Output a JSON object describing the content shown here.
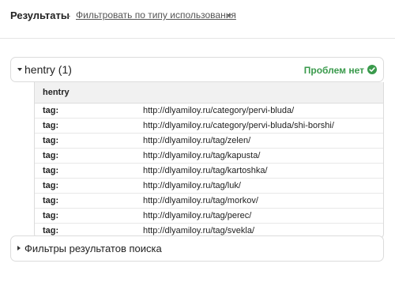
{
  "header": {
    "title": "Результаты",
    "separator": "-",
    "filter_link": "Фильтровать по типу использования"
  },
  "hentry_panel": {
    "title": "hentry (1)",
    "status": "Проблем нет",
    "status_icon": "check-circle-icon",
    "status_color": "#3a9a4c"
  },
  "table": {
    "header": "hentry",
    "rows": [
      {
        "key": "tag:",
        "value": "http://dlyamiloy.ru/category/pervi-bluda/"
      },
      {
        "key": "tag:",
        "value": "http://dlyamiloy.ru/category/pervi-bluda/shi-borshi/"
      },
      {
        "key": "tag:",
        "value": "http://dlyamiloy.ru/tag/zelen/"
      },
      {
        "key": "tag:",
        "value": "http://dlyamiloy.ru/tag/kapusta/"
      },
      {
        "key": "tag:",
        "value": "http://dlyamiloy.ru/tag/kartoshka/"
      },
      {
        "key": "tag:",
        "value": "http://dlyamiloy.ru/tag/luk/"
      },
      {
        "key": "tag:",
        "value": "http://dlyamiloy.ru/tag/morkov/"
      },
      {
        "key": "tag:",
        "value": "http://dlyamiloy.ru/tag/perec/"
      },
      {
        "key": "tag:",
        "value": "http://dlyamiloy.ru/tag/svekla/"
      }
    ]
  },
  "filters_panel": {
    "title": "Фильтры результатов поиска"
  }
}
